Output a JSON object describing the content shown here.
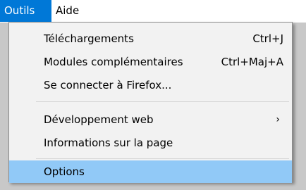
{
  "menubar": {
    "items": [
      {
        "label": "Outils",
        "active": true
      },
      {
        "label": "Aide",
        "active": false
      }
    ]
  },
  "menu": {
    "items": [
      {
        "label": "Téléchargements",
        "shortcut": "Ctrl+J"
      },
      {
        "label": "Modules complémentaires",
        "shortcut": "Ctrl+Maj+A"
      },
      {
        "label": "Se connecter à Firefox..."
      },
      {
        "label": "Développement web",
        "submenu": true,
        "arrow": "›"
      },
      {
        "label": "Informations sur la page"
      },
      {
        "label": "Options",
        "selected": true
      }
    ]
  },
  "colors": {
    "menubar_active": "#0078d7",
    "selected_item": "#91c9f7"
  }
}
